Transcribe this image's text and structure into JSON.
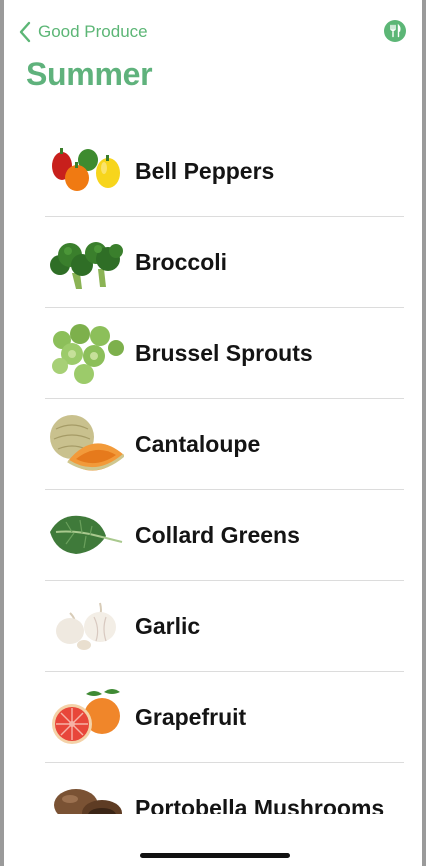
{
  "nav": {
    "back_label": "Good Produce",
    "title": "Summer",
    "action_icon": "fork-knife-icon"
  },
  "produce": [
    {
      "label": "Bell Peppers",
      "icon": "bell-peppers-image"
    },
    {
      "label": "Broccoli",
      "icon": "broccoli-image"
    },
    {
      "label": "Brussel Sprouts",
      "icon": "brussel-sprouts-image"
    },
    {
      "label": "Cantaloupe",
      "icon": "cantaloupe-image"
    },
    {
      "label": "Collard Greens",
      "icon": "collard-greens-image"
    },
    {
      "label": "Garlic",
      "icon": "garlic-image"
    },
    {
      "label": "Grapefruit",
      "icon": "grapefruit-image"
    },
    {
      "label": "Portobella Mushrooms",
      "icon": "portobella-mushrooms-image"
    }
  ],
  "colors": {
    "accent": "#5cb676",
    "title": "#5fb27c",
    "separator": "#dcdcdc"
  }
}
